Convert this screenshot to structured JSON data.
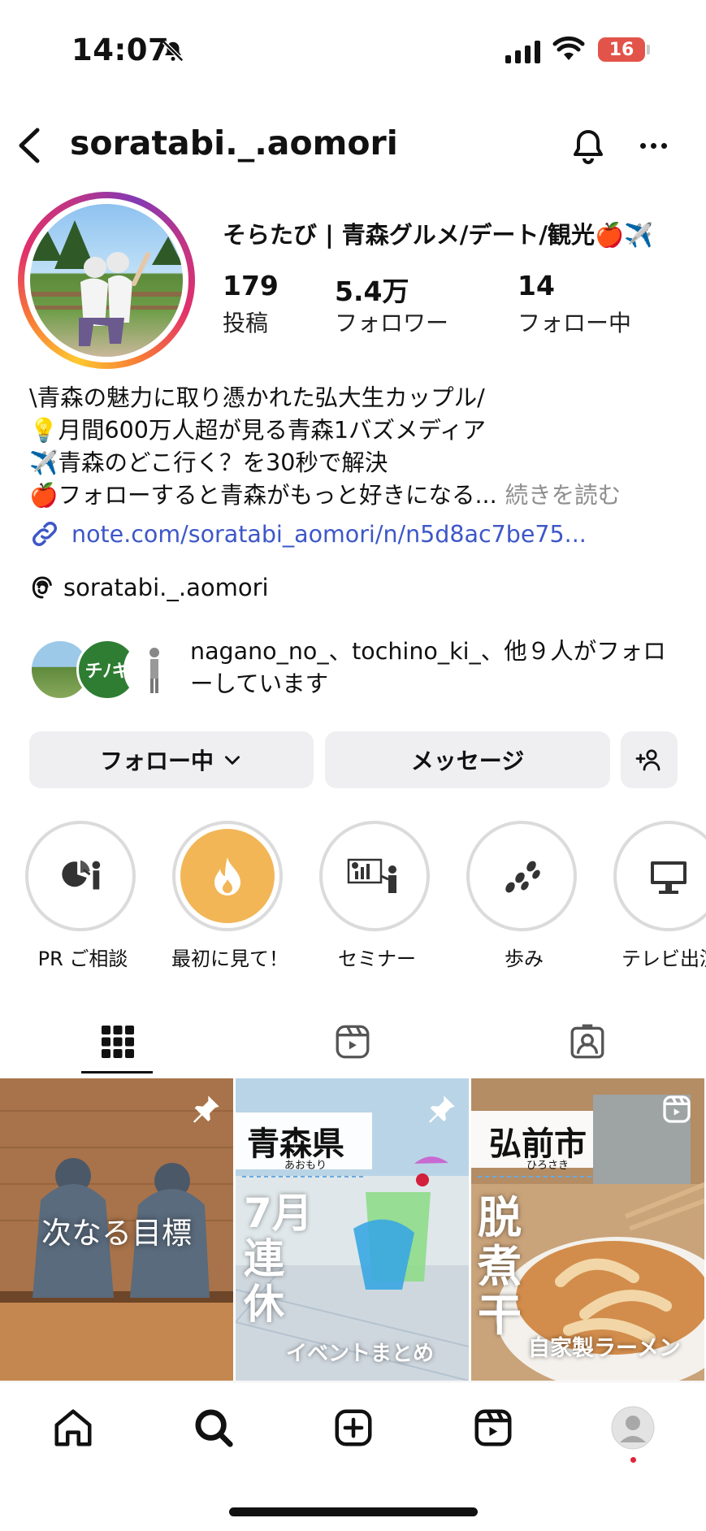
{
  "status_bar": {
    "time": "14:07",
    "battery": "16"
  },
  "header": {
    "username": "soratabi._.aomori"
  },
  "profile": {
    "display_name": "そらたび | 青森グルメ/デート/観光🍎✈️",
    "stats": [
      {
        "value": "179",
        "label": "投稿"
      },
      {
        "value": "5.4万",
        "label": "フォロワー"
      },
      {
        "value": "14",
        "label": "フォロー中"
      }
    ],
    "bio_lines": [
      "\\青森の魅力に取り憑かれた弘大生カップル/",
      "💡月間600万人超が見る青森1バズメディア",
      "✈️青森のどこ行く？を30秒で解決",
      "🍎フォローすると青森がもっと好きになる..."
    ],
    "bio_more": "続きを読む",
    "link": "note.com/soratabi_aomori/n/n5d8ac7be75...",
    "threads_handle": "soratabi._.aomori",
    "followed_by": "nagano_no_、tochino_ki_、他９人がフォローしています"
  },
  "actions": {
    "follow": "フォロー中",
    "message": "メッセージ"
  },
  "highlights": [
    {
      "label": "PR ご相談",
      "icon": "consult-icon"
    },
    {
      "label": "最初に見て！",
      "icon": "flame-icon"
    },
    {
      "label": "セミナー",
      "icon": "presentation-icon"
    },
    {
      "label": "歩み",
      "icon": "footsteps-icon"
    },
    {
      "label": "テレビ出演",
      "icon": "monitor-icon"
    }
  ],
  "tabs": [
    "grid-icon",
    "reels-icon",
    "tagged-icon"
  ],
  "posts": [
    {
      "text": "次なる目標",
      "pinned": true
    },
    {
      "title": "青森県",
      "furigana": "あおもり",
      "big": [
        "7月",
        "連",
        "休"
      ],
      "caption": "イベントまとめ",
      "pinned": true
    },
    {
      "title": "弘前市",
      "furigana": "ひろさき",
      "big": [
        "脱",
        "煮",
        "干"
      ],
      "caption": "自家製ラーメン",
      "reel": true
    }
  ],
  "bottom_nav": [
    "home-icon",
    "search-icon",
    "create-icon",
    "reels-icon",
    "profile-avatar"
  ],
  "colors": {
    "link": "#3d57c7",
    "button_bg": "#efeff2",
    "highlight_fire": "#f2b657"
  }
}
